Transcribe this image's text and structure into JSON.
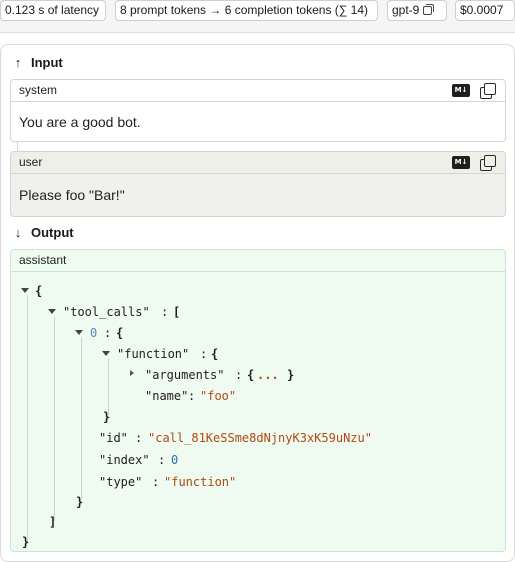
{
  "metrics": {
    "latency": "0.123 s of latency",
    "tokens": "8 prompt tokens → 6 completion tokens (∑ 14)",
    "model": "gpt-9",
    "cost": "$0.0007"
  },
  "input": {
    "title": "Input",
    "messages": [
      {
        "role": "system",
        "content": "You are a good bot."
      },
      {
        "role": "user",
        "content": "Please foo \"Bar!\""
      }
    ],
    "md_label": "M↓"
  },
  "output": {
    "title": "Output",
    "role": "assistant",
    "tree": {
      "open_brace": "{",
      "tool_calls_key": "\"tool_calls\"",
      "colon": ":",
      "open_bracket": "[",
      "index0": "0",
      "function_key": "\"function\"",
      "arguments_key": "\"arguments\"",
      "arguments_collapsed_open": "{",
      "arguments_ellipsis": "...",
      "arguments_collapsed_close": "}",
      "name_key": "\"name\"",
      "name_value": "\"foo\"",
      "close_brace": "}",
      "id_key": "\"id\"",
      "id_value": "\"call_81KeSSme8dNjnyK3xK59uNzu\"",
      "index_key": "\"index\"",
      "index_value": "0",
      "type_key": "\"type\"",
      "type_value": "\"function\"",
      "close_bracket": "]"
    }
  },
  "colors": {
    "string": "#b04a14",
    "number": "#2a6fb5",
    "assistant_bg": "#effaf1",
    "user_bg": "#f0f0ec"
  },
  "icons": {
    "input_arrow": "arrow-up-icon",
    "output_arrow": "arrow-down-icon",
    "markdown": "markdown-icon",
    "copy": "copy-icon"
  }
}
